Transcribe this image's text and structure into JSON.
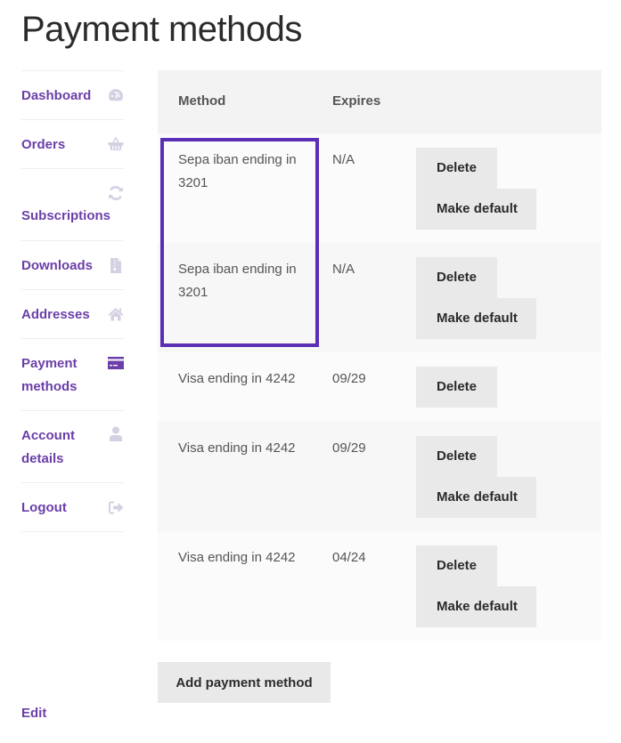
{
  "page": {
    "title": "Payment methods"
  },
  "colors": {
    "accent": "#6b3fa8",
    "highlight": "#5b2fb5",
    "icon_muted": "#d6d0e3",
    "button_bg": "#e9e9e9"
  },
  "nav": {
    "items": [
      {
        "label": "Dashboard",
        "icon": "dashboard-gauge-icon",
        "active": false
      },
      {
        "label": "Orders",
        "icon": "basket-icon",
        "active": false
      },
      {
        "label": "Subscriptions",
        "icon": "refresh-icon",
        "active": false
      },
      {
        "label": "Downloads",
        "icon": "file-archive-icon",
        "active": false
      },
      {
        "label": "Addresses",
        "icon": "home-icon",
        "active": false
      },
      {
        "label": "Payment methods",
        "icon": "credit-card-icon",
        "active": true
      },
      {
        "label": "Account details",
        "icon": "user-icon",
        "active": false
      },
      {
        "label": "Logout",
        "icon": "sign-out-icon",
        "active": false
      }
    ]
  },
  "table": {
    "headers": {
      "method": "Method",
      "expires": "Expires"
    },
    "rows": [
      {
        "method": "Sepa iban ending in 3201",
        "expires": "N/A",
        "actions": [
          "Delete",
          "Make default"
        ]
      },
      {
        "method": "Sepa iban ending in 3201",
        "expires": "N/A",
        "actions": [
          "Delete",
          "Make default"
        ]
      },
      {
        "method": "Visa ending in 4242",
        "expires": "09/29",
        "actions": [
          "Delete"
        ]
      },
      {
        "method": "Visa ending in 4242",
        "expires": "09/29",
        "actions": [
          "Delete",
          "Make default"
        ]
      },
      {
        "method": "Visa ending in 4242",
        "expires": "04/24",
        "actions": [
          "Delete",
          "Make default"
        ]
      }
    ]
  },
  "actions": {
    "add_payment_method": "Add payment method",
    "edit": "Edit"
  }
}
